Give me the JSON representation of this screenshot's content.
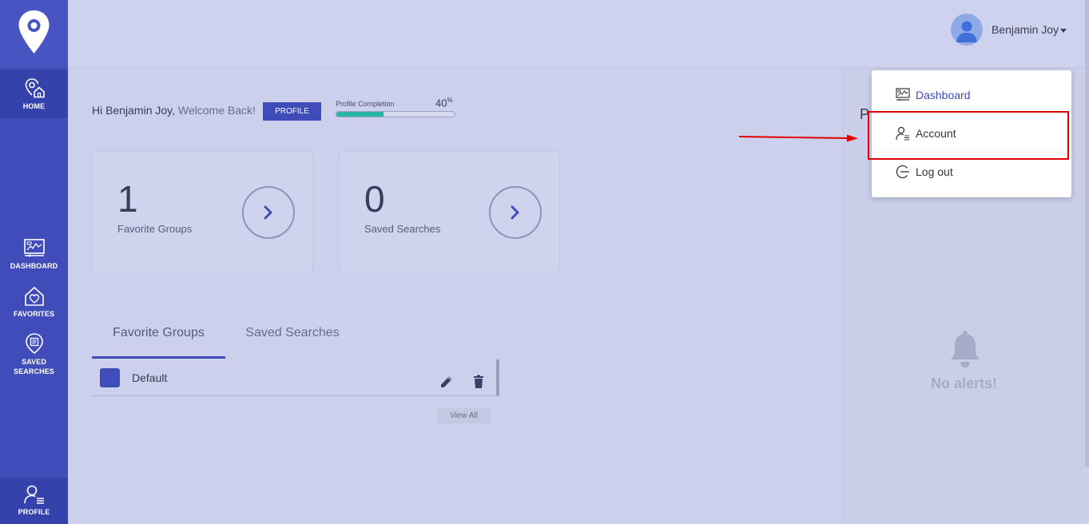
{
  "sidebar": {
    "items": [
      {
        "label": "HOME",
        "icon": "home-pin-icon"
      },
      {
        "label": "DASHBOARD",
        "icon": "dashboard-icon"
      },
      {
        "label": "FAVORITES",
        "icon": "heart-home-icon"
      },
      {
        "label": "SAVED",
        "label2": "SEARCHES",
        "icon": "saved-search-icon"
      },
      {
        "label": "PROFILE",
        "icon": "profile-icon"
      }
    ]
  },
  "header": {
    "user_name": "Benjamin Joy"
  },
  "welcome": {
    "greeting": "Hi Benjamin Joy,",
    "message": " Welcome Back!",
    "profile_button": "PROFILE",
    "completion_label": "Profile Completion",
    "completion_value": "40",
    "completion_unit": "%",
    "completion_fraction": 0.4
  },
  "cards": [
    {
      "count": "1",
      "label": "Favorite Groups"
    },
    {
      "count": "0",
      "label": "Saved Searches"
    }
  ],
  "tabs": {
    "favorite_groups": "Favorite Groups",
    "saved_searches": "Saved Searches",
    "active": "Favorite Groups"
  },
  "list": {
    "rows": [
      {
        "name": "Default"
      }
    ],
    "view_all": "View All"
  },
  "right_panel": {
    "title": "P",
    "empty_message": "No alerts!"
  },
  "dropdown": {
    "items": [
      {
        "label": "Dashboard",
        "icon": "dashboard-icon"
      },
      {
        "label": "Account",
        "icon": "account-icon"
      },
      {
        "label": "Log out",
        "icon": "logout-icon"
      }
    ]
  },
  "colors": {
    "primary": "#3f4cba",
    "progress": "#2bb5a8",
    "highlight": "#e00000"
  }
}
